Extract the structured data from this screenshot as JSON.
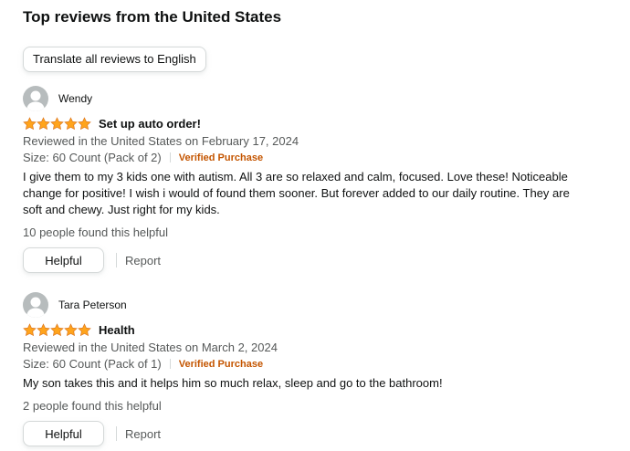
{
  "section": {
    "title": "Top reviews from the United States",
    "translate_label": "Translate all reviews to English"
  },
  "colors": {
    "star": "#ffa41c",
    "verified": "#c45500",
    "secondary_text": "#565959"
  },
  "reviews": [
    {
      "profile_name": "Wendy",
      "rating": 5,
      "headline": "Set up auto order!",
      "date": "Reviewed in the United States on February 17, 2024",
      "size": "Size: 60 Count (Pack of 2)",
      "verified": "Verified Purchase",
      "body": "I give them to my 3 kids one with autism. All 3 are so relaxed and calm, focused. Love these! Noticeable change for positive! I wish i would of found them sooner. But forever added to our daily routine. They are soft and chewy. Just right for my kids.",
      "helpful_count": "10 people found this helpful",
      "helpful_label": "Helpful",
      "report_label": "Report"
    },
    {
      "profile_name": "Tara Peterson",
      "rating": 5,
      "headline": "Health",
      "date": "Reviewed in the United States on March 2, 2024",
      "size": "Size: 60 Count (Pack of 1)",
      "verified": "Verified Purchase",
      "body": "My son takes this and it helps him so much relax, sleep and go to the bathroom!",
      "helpful_count": "2 people found this helpful",
      "helpful_label": "Helpful",
      "report_label": "Report"
    }
  ]
}
